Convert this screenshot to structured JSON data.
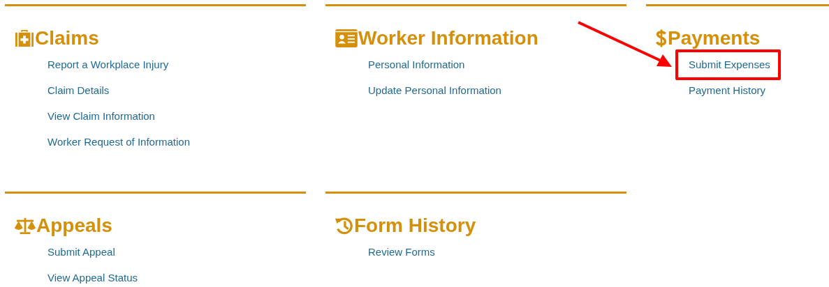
{
  "sections": [
    {
      "title": "Claims",
      "links": [
        {
          "label": "Report a Workplace Injury",
          "highlighted": false
        },
        {
          "label": "Claim Details",
          "highlighted": false
        },
        {
          "label": "View Claim Information",
          "highlighted": false
        },
        {
          "label": "Worker Request of Information",
          "highlighted": false
        }
      ]
    },
    {
      "title": "Worker Information",
      "links": [
        {
          "label": "Personal Information",
          "highlighted": false
        },
        {
          "label": "Update Personal Information",
          "highlighted": false
        }
      ]
    },
    {
      "title": "Payments",
      "links": [
        {
          "label": "Submit Expenses",
          "highlighted": true
        },
        {
          "label": "Payment History",
          "highlighted": false
        }
      ]
    },
    {
      "title": "Appeals",
      "links": [
        {
          "label": "Submit Appeal",
          "highlighted": false
        },
        {
          "label": "View Appeal Status",
          "highlighted": false
        }
      ]
    },
    {
      "title": "Form History",
      "links": [
        {
          "label": "Review Forms",
          "highlighted": false
        }
      ]
    }
  ]
}
